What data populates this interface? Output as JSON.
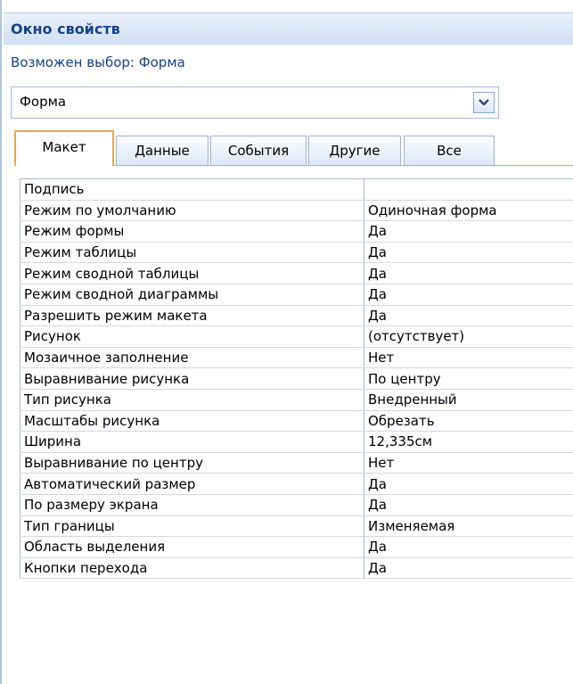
{
  "panel": {
    "title": "Окно свойств",
    "selection_label": "Возможен выбор:  Форма"
  },
  "selector": {
    "value": "Форма",
    "dropdown_icon": "chevron-down-icon"
  },
  "tabs": [
    {
      "label": "Макет",
      "active": true
    },
    {
      "label": "Данные",
      "active": false
    },
    {
      "label": "События",
      "active": false
    },
    {
      "label": "Другие",
      "active": false
    },
    {
      "label": "Все",
      "active": false
    }
  ],
  "properties": [
    {
      "name": "Подпись",
      "value": ""
    },
    {
      "name": "Режим по умолчанию",
      "value": "Одиночная форма"
    },
    {
      "name": "Режим формы",
      "value": "Да"
    },
    {
      "name": "Режим таблицы",
      "value": "Да"
    },
    {
      "name": "Режим сводной таблицы",
      "value": "Да"
    },
    {
      "name": "Режим сводной диаграммы",
      "value": "Да"
    },
    {
      "name": "Разрешить режим макета",
      "value": "Да"
    },
    {
      "name": "Рисунок",
      "value": "(отсутствует)"
    },
    {
      "name": "Мозаичное заполнение",
      "value": "Нет"
    },
    {
      "name": "Выравнивание рисунка",
      "value": "По центру"
    },
    {
      "name": "Тип рисунка",
      "value": "Внедренный"
    },
    {
      "name": "Масштабы рисунка",
      "value": "Обрезать"
    },
    {
      "name": "Ширина",
      "value": "12,335см"
    },
    {
      "name": "Выравнивание по центру",
      "value": "Нет"
    },
    {
      "name": "Автоматический размер",
      "value": "Да"
    },
    {
      "name": "По размеру экрана",
      "value": "Да"
    },
    {
      "name": "Тип границы",
      "value": "Изменяемая"
    },
    {
      "name": "Область выделения",
      "value": "Да"
    },
    {
      "name": "Кнопки перехода",
      "value": "Да"
    }
  ],
  "colors": {
    "title_text": "#15428b",
    "active_tab_border": "#e8a94f",
    "header_band": "#d2e0f3"
  }
}
